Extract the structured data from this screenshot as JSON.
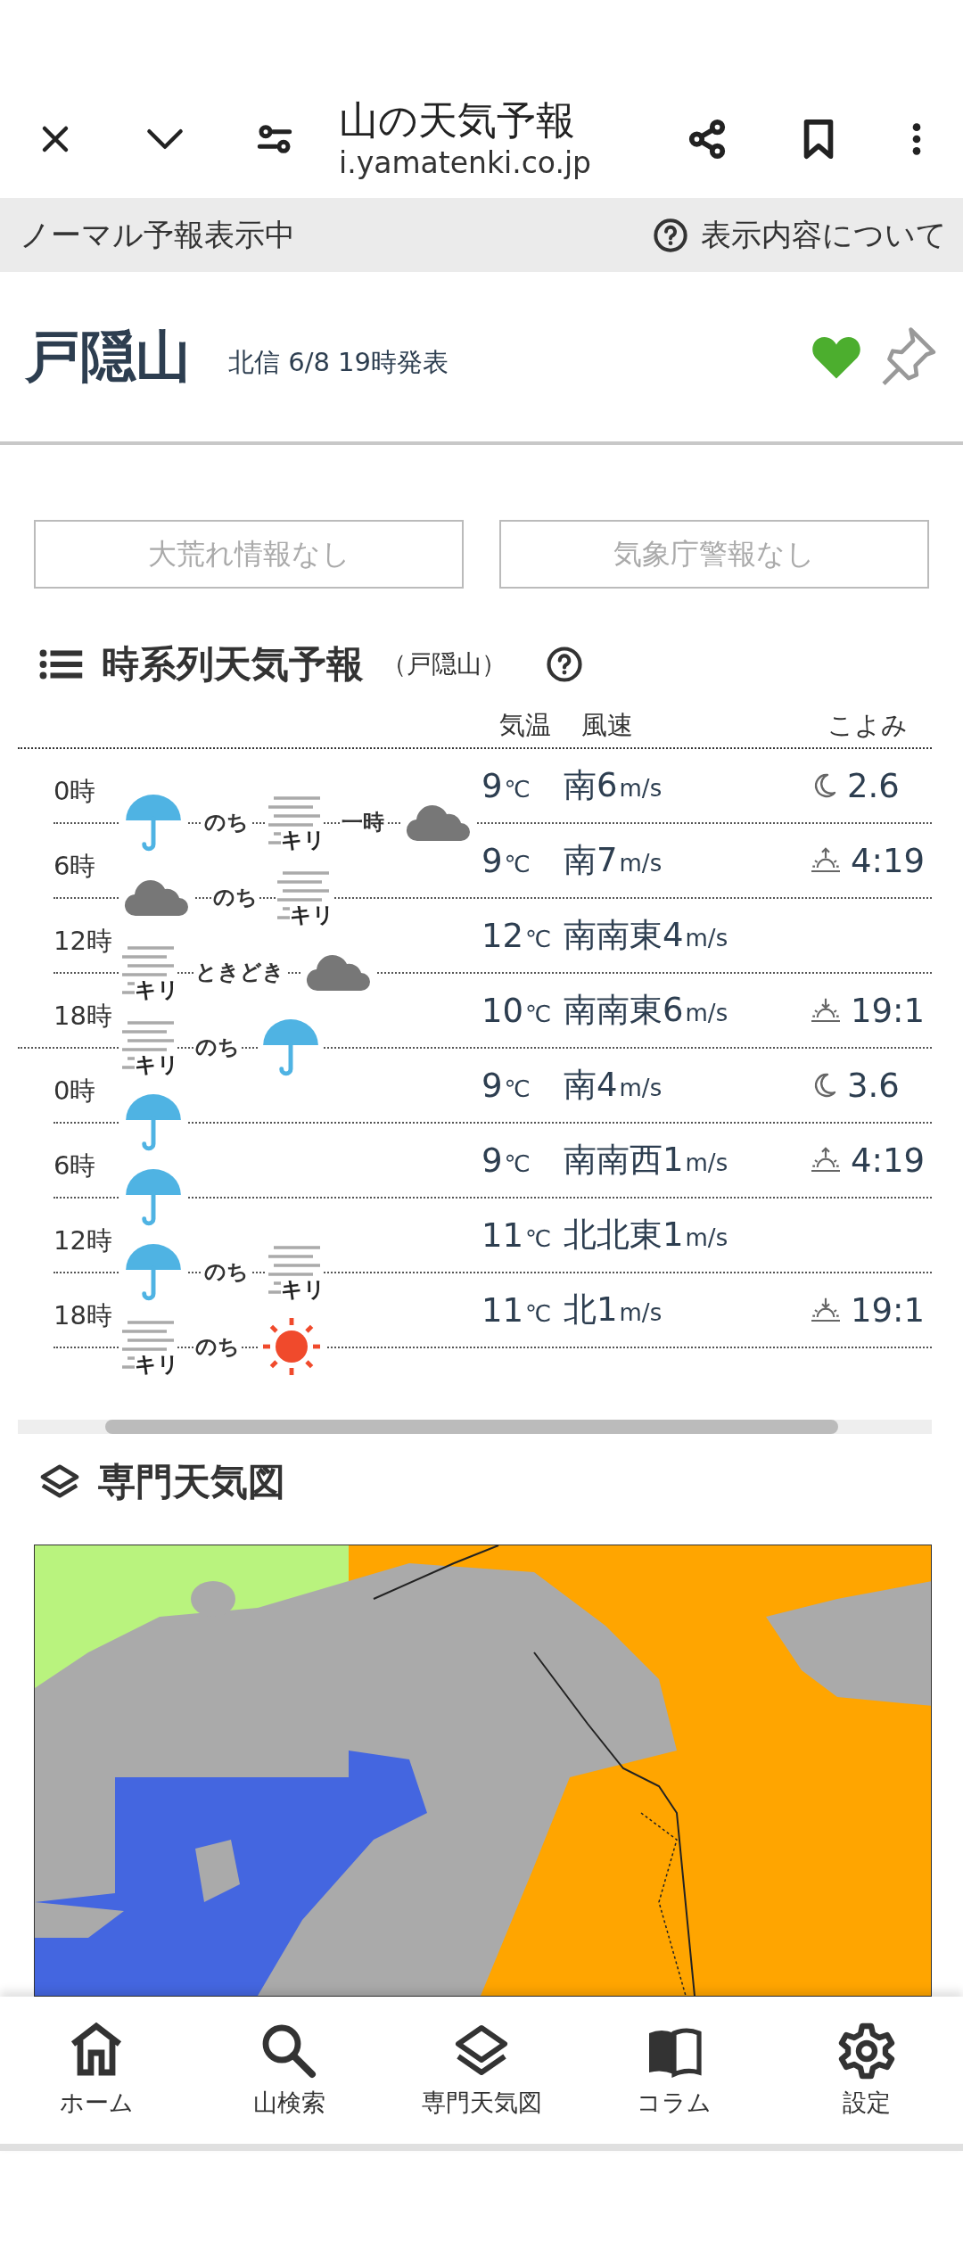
{
  "browser_bar": {
    "title": "山の天気予報",
    "url": "i.yamatenki.co.jp"
  },
  "info_bar": {
    "mode": "ノーマル予報表示中",
    "help_link": "表示内容について"
  },
  "mountain": {
    "name": "戸隠山",
    "issued": "北信 6/8 19時発表",
    "favorite": true,
    "pinned": false
  },
  "alerts": [
    "大荒れ情報なし",
    "気象庁警報なし"
  ],
  "forecast": {
    "title": "時系列天気予報",
    "subtitle": "（戸隠山）",
    "columns": [
      "気温",
      "風速",
      "こよみ"
    ],
    "days": [
      {
        "rows": [
          {
            "time": "0時",
            "temp": "9",
            "temp_unit": "℃",
            "wind": "南6",
            "wind_unit": "m/s",
            "almanac": {
              "kind": "moon",
              "text": "2.6"
            },
            "weather": [
              {
                "kind": "rain"
              },
              {
                "kind": "word",
                "text": "のち"
              },
              {
                "kind": "fog",
                "label": "キリ"
              },
              {
                "kind": "word",
                "text": "一時"
              },
              {
                "kind": "cloud"
              }
            ]
          },
          {
            "time": "6時",
            "temp": "9",
            "temp_unit": "℃",
            "wind": "南7",
            "wind_unit": "m/s",
            "almanac": {
              "kind": "sunrise",
              "text": "4:19"
            },
            "weather": [
              {
                "kind": "cloud"
              },
              {
                "kind": "word",
                "text": "のち"
              },
              {
                "kind": "fog",
                "label": "キリ"
              }
            ]
          },
          {
            "time": "12時",
            "temp": "12",
            "temp_unit": "℃",
            "wind": "南南東4",
            "wind_unit": "m/s",
            "weather": [
              {
                "kind": "fog",
                "label": "キリ"
              },
              {
                "kind": "word",
                "text": "ときどき"
              },
              {
                "kind": "cloud"
              }
            ]
          },
          {
            "time": "18時",
            "temp": "10",
            "temp_unit": "℃",
            "wind": "南南東6",
            "wind_unit": "m/s",
            "almanac": {
              "kind": "sunset",
              "text": "19:1"
            },
            "weather": [
              {
                "kind": "fog",
                "label": "キリ"
              },
              {
                "kind": "word",
                "text": "のち"
              },
              {
                "kind": "rain"
              }
            ]
          }
        ]
      },
      {
        "rows": [
          {
            "time": "0時",
            "temp": "9",
            "temp_unit": "℃",
            "wind": "南4",
            "wind_unit": "m/s",
            "almanac": {
              "kind": "moon",
              "text": "3.6"
            },
            "weather": [
              {
                "kind": "rain"
              }
            ]
          },
          {
            "time": "6時",
            "temp": "9",
            "temp_unit": "℃",
            "wind": "南南西1",
            "wind_unit": "m/s",
            "almanac": {
              "kind": "sunrise",
              "text": "4:19"
            },
            "weather": [
              {
                "kind": "rain"
              }
            ]
          },
          {
            "time": "12時",
            "temp": "11",
            "temp_unit": "℃",
            "wind": "北北東1",
            "wind_unit": "m/s",
            "weather": [
              {
                "kind": "rain"
              },
              {
                "kind": "word",
                "text": "のち"
              },
              {
                "kind": "fog",
                "label": "キリ"
              }
            ]
          },
          {
            "time": "18時",
            "temp": "11",
            "temp_unit": "℃",
            "wind": "北1",
            "wind_unit": "m/s",
            "almanac": {
              "kind": "sunset",
              "text": "19:1"
            },
            "weather": [
              {
                "kind": "fog",
                "label": "キリ"
              },
              {
                "kind": "word",
                "text": "のち"
              },
              {
                "kind": "sun"
              }
            ]
          }
        ]
      }
    ]
  },
  "weather_map": {
    "title": "専門天気図"
  },
  "nav": [
    {
      "label": "ホーム"
    },
    {
      "label": "山検索"
    },
    {
      "label": "専門天気図"
    },
    {
      "label": "コラム"
    },
    {
      "label": "設定"
    }
  ]
}
